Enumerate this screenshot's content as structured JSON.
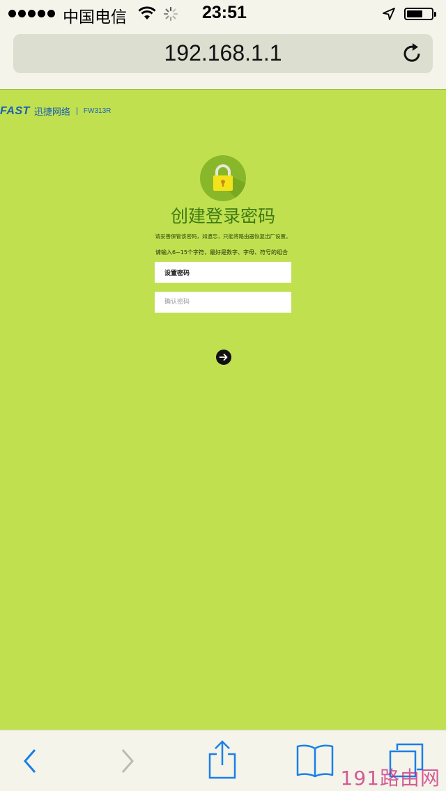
{
  "status_bar": {
    "carrier": "中国电信",
    "time": "23:51",
    "icons": [
      "signal-dots-icon",
      "wifi-icon",
      "activity-spinner-icon",
      "location-arrow-icon",
      "battery-icon"
    ]
  },
  "browser": {
    "url": "192.168.1.1",
    "icons": [
      "reload-icon",
      "back-icon",
      "forward-icon",
      "share-icon",
      "bookmarks-icon",
      "tabs-icon"
    ]
  },
  "page": {
    "brand": {
      "logo": "FAST",
      "name": "迅捷网络",
      "model": "FW313R"
    },
    "title": "创建登录密码",
    "tip": "请妥善保管该密码，如遗忘，只能将路由器恢复出厂设置。",
    "rule": "请输入6~15个字符，最好是数字、字母、符号的组合",
    "password_field": {
      "value": "设置密码"
    },
    "confirm_field": {
      "placeholder": "确认密码"
    },
    "next_icon": "arrow-right-icon"
  },
  "watermark": "191路由网",
  "colors": {
    "page_background": "#c0e050",
    "title_green": "#3e7a12",
    "brand_blue": "#1a5fb4",
    "browser_blue": "#1a7fe8",
    "lock_yellow": "#f5e31a"
  }
}
